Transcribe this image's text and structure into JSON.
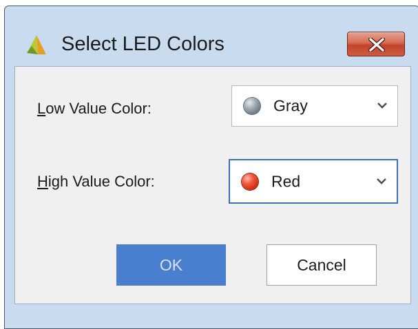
{
  "dialog": {
    "title": "Select LED Colors",
    "close_icon": "close-icon"
  },
  "fields": {
    "low": {
      "label_mnemonic": "L",
      "label_rest": "ow Value Color:",
      "value": "Gray",
      "led_color": "#8a96a0"
    },
    "high": {
      "label_mnemonic": "H",
      "label_rest": "igh Value Color:",
      "value": "Red",
      "led_color": "#e03a1e"
    }
  },
  "buttons": {
    "ok_label": "OK",
    "cancel_label": "Cancel"
  },
  "colors": {
    "accent": "#4a7fd0",
    "focus_border": "#3b6ebc",
    "close_button": "#c9452e",
    "frame": "#c9dcef"
  }
}
